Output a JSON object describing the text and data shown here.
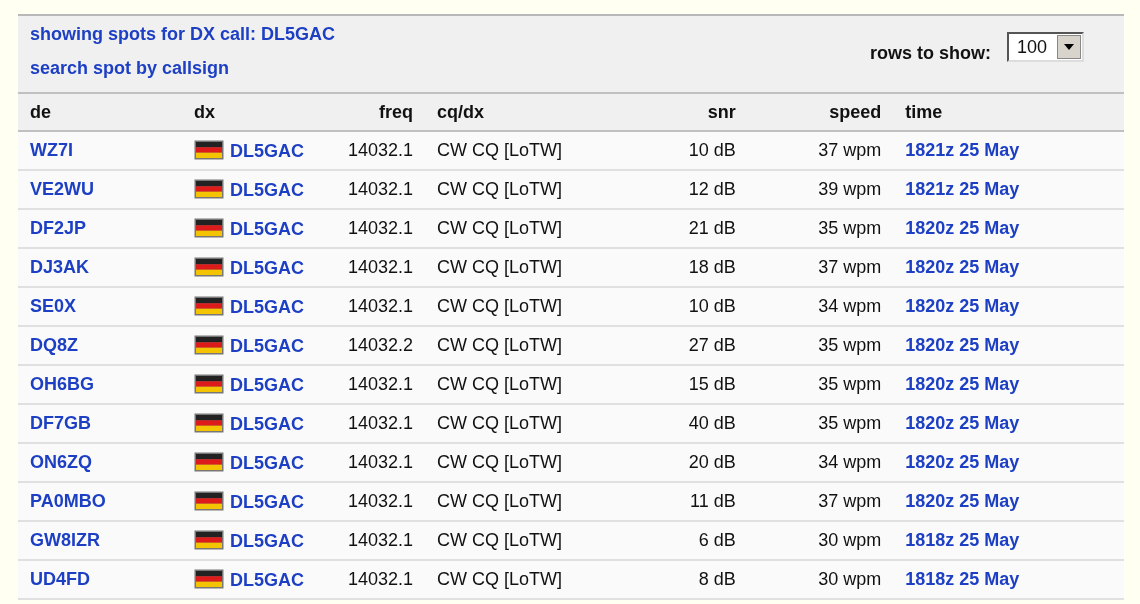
{
  "header": {
    "title_link": "showing spots for DX call: DL5GAC",
    "search_link": "search spot by callsign",
    "rows_label": "rows to show:",
    "rows_value": "100"
  },
  "table": {
    "columns": [
      "de",
      "dx",
      "freq",
      "cq/dx",
      "snr",
      "speed",
      "time"
    ],
    "rows": [
      {
        "de": "WZ7I",
        "dx": "DL5GAC",
        "freq": "14032.1",
        "mode": "CW CQ [LoTW]",
        "snr": "10 dB",
        "speed": "37 wpm",
        "time": "1821z 25 May"
      },
      {
        "de": "VE2WU",
        "dx": "DL5GAC",
        "freq": "14032.1",
        "mode": "CW CQ [LoTW]",
        "snr": "12 dB",
        "speed": "39 wpm",
        "time": "1821z 25 May"
      },
      {
        "de": "DF2JP",
        "dx": "DL5GAC",
        "freq": "14032.1",
        "mode": "CW CQ [LoTW]",
        "snr": "21 dB",
        "speed": "35 wpm",
        "time": "1820z 25 May"
      },
      {
        "de": "DJ3AK",
        "dx": "DL5GAC",
        "freq": "14032.1",
        "mode": "CW CQ [LoTW]",
        "snr": "18 dB",
        "speed": "37 wpm",
        "time": "1820z 25 May"
      },
      {
        "de": "SE0X",
        "dx": "DL5GAC",
        "freq": "14032.1",
        "mode": "CW CQ [LoTW]",
        "snr": "10 dB",
        "speed": "34 wpm",
        "time": "1820z 25 May"
      },
      {
        "de": "DQ8Z",
        "dx": "DL5GAC",
        "freq": "14032.2",
        "mode": "CW CQ [LoTW]",
        "snr": "27 dB",
        "speed": "35 wpm",
        "time": "1820z 25 May"
      },
      {
        "de": "OH6BG",
        "dx": "DL5GAC",
        "freq": "14032.1",
        "mode": "CW CQ [LoTW]",
        "snr": "15 dB",
        "speed": "35 wpm",
        "time": "1820z 25 May"
      },
      {
        "de": "DF7GB",
        "dx": "DL5GAC",
        "freq": "14032.1",
        "mode": "CW CQ [LoTW]",
        "snr": "40 dB",
        "speed": "35 wpm",
        "time": "1820z 25 May"
      },
      {
        "de": "ON6ZQ",
        "dx": "DL5GAC",
        "freq": "14032.1",
        "mode": "CW CQ [LoTW]",
        "snr": "20 dB",
        "speed": "34 wpm",
        "time": "1820z 25 May"
      },
      {
        "de": "PA0MBO",
        "dx": "DL5GAC",
        "freq": "14032.1",
        "mode": "CW CQ [LoTW]",
        "snr": "11 dB",
        "speed": "37 wpm",
        "time": "1820z 25 May"
      },
      {
        "de": "GW8IZR",
        "dx": "DL5GAC",
        "freq": "14032.1",
        "mode": "CW CQ [LoTW]",
        "snr": "6 dB",
        "speed": "30 wpm",
        "time": "1818z 25 May"
      },
      {
        "de": "UD4FD",
        "dx": "DL5GAC",
        "freq": "14032.1",
        "mode": "CW CQ [LoTW]",
        "snr": "8 dB",
        "speed": "30 wpm",
        "time": "1818z 25 May"
      }
    ]
  }
}
